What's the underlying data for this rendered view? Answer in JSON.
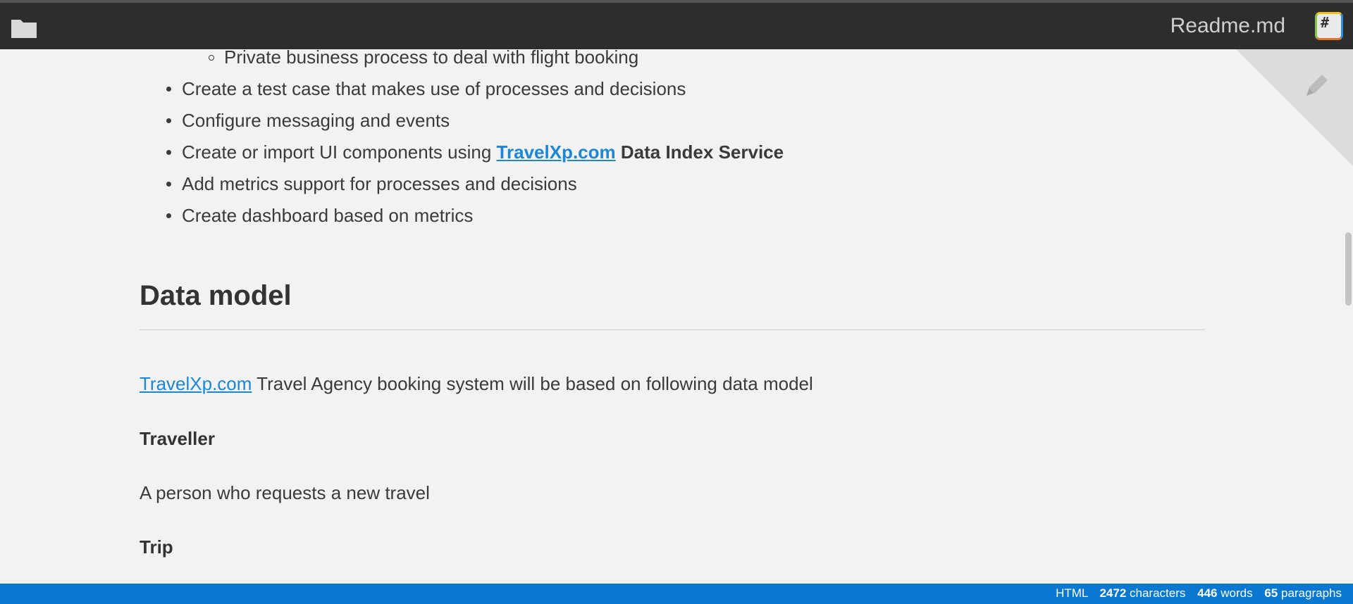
{
  "topbar": {
    "title": "Readme.md",
    "folder_icon": "folder-icon",
    "hash_label": "#"
  },
  "content": {
    "list_items": [
      {
        "text": "Private business process to deal with flight booking",
        "level": 2
      },
      {
        "text": "Create a test case that makes use of processes and decisions",
        "level": 1
      },
      {
        "text": "Configure messaging and events",
        "level": 1
      },
      {
        "prefix": "Create or import UI components using ",
        "link": "TravelXp.com",
        "suffix": "Data Index Service",
        "level": 1
      },
      {
        "text": "Add metrics support for processes and decisions",
        "level": 1
      },
      {
        "text": "Create dashboard based on metrics",
        "level": 1
      }
    ],
    "section_title": "Data model",
    "intro_link": "TravelXp.com",
    "intro_text": " Travel Agency booking system will be based on following data model",
    "traveller_heading": "Traveller",
    "traveller_desc": "A person who requests a new travel",
    "trip_heading": "Trip"
  },
  "statusbar": {
    "format": "HTML",
    "characters_count": "2472",
    "characters_label": "characters",
    "words_count": "446",
    "words_label": "words",
    "paragraphs_count": "65",
    "paragraphs_label": "paragraphs"
  },
  "colors": {
    "link": "#1b87d6",
    "statusbar": "#0a77d0",
    "topbar": "#2d2d2d"
  }
}
